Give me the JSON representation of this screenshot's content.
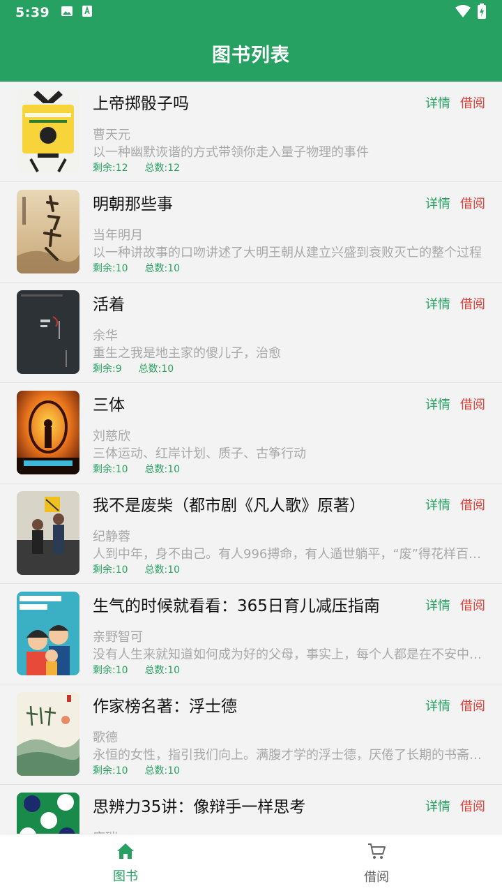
{
  "status_bar": {
    "time": "5:39"
  },
  "header": {
    "title": "图书列表"
  },
  "colors": {
    "primary": "#26a162",
    "borrow": "#e0403a",
    "muted": "#a8a8a8"
  },
  "actions": {
    "detail_label": "详情",
    "borrow_label": "借阅"
  },
  "books": [
    {
      "title": "上帝掷骰子吗",
      "author": "曹天元",
      "desc": "以一种幽默诙谐的方式带领你走入量子物理的事件",
      "remaining": "剩余:12",
      "total": "总数:12",
      "cover_icon": "dice-book-cover"
    },
    {
      "title": "明朝那些事",
      "author": "当年明月",
      "desc": "以一种讲故事的口吻讲述了大明王朝从建立兴盛到衰败灭亡的整个过程",
      "remaining": "剩余:10",
      "total": "总数:10",
      "cover_icon": "ming-dynasty-cover"
    },
    {
      "title": "活着",
      "author": "余华",
      "desc": "重生之我是地主家的傻儿子，治愈",
      "remaining": "剩余:9",
      "total": "总数:10",
      "cover_icon": "to-live-cover"
    },
    {
      "title": "三体",
      "author": "刘慈欣",
      "desc": "三体运动、红岸计划、质子、古筝行动",
      "remaining": "剩余:10",
      "total": "总数:10",
      "cover_icon": "three-body-cover"
    },
    {
      "title": "我不是废柴（都市剧《凡人歌》原著）",
      "author": "纪静蓉",
      "desc": "人到中年，身不由己。有人996搏命，有人遁世躺平，“废”得花样百出…",
      "remaining": "剩余:10",
      "total": "总数:10",
      "cover_icon": "couple-photo-cover"
    },
    {
      "title": "生气的时候就看看：365日育儿减压指南",
      "author": "亲野智可",
      "desc": "没有人生来就知道如何成为好的父母，事实上，每个人都是在不安中…",
      "remaining": "剩余:10",
      "total": "总数:10",
      "cover_icon": "parenting-illustration-cover"
    },
    {
      "title": "作家榜名著：浮士德",
      "author": "歌德",
      "desc": "永恒的女性，指引我们向上。满腹才学的浮士德，厌倦了长期的书斋…",
      "remaining": "剩余:10",
      "total": "总数:10",
      "cover_icon": "faust-landscape-cover"
    },
    {
      "title": "思辨力35讲：像辩手一样思考",
      "author": "席瑞",
      "desc": "",
      "remaining": "",
      "total": "",
      "cover_icon": "polka-dot-cover"
    }
  ],
  "bottom_nav": [
    {
      "label": "图书",
      "icon": "home-icon",
      "active": true
    },
    {
      "label": "借阅",
      "icon": "cart-icon",
      "active": false
    }
  ]
}
